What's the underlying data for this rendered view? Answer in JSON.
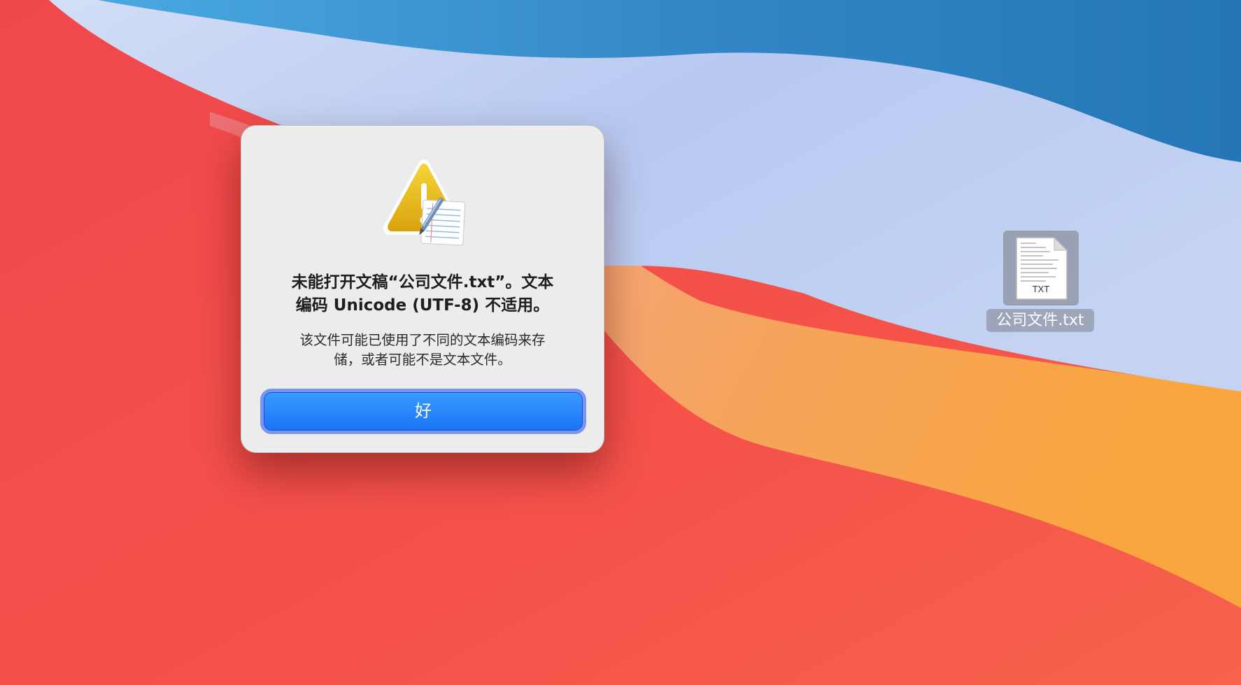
{
  "alert": {
    "icon": "caution-textedit-icon",
    "title_lines": [
      "未能打开文稿“公司文件.txt”。文本",
      "编码 Unicode (UTF-8) 不适用。"
    ],
    "message_lines": [
      "该文件可能已使用了不同的文本编码来存",
      "储，或者可能不是文本文件。"
    ],
    "ok_label": "好"
  },
  "desktop": {
    "file": {
      "icon": "txt-document-icon",
      "extension_badge": "TXT",
      "name": "公司文件.txt"
    }
  },
  "colors": {
    "accent": "#1a74f5",
    "dialog_bg": "#ececec",
    "wallpaper_red": "#f24e4a",
    "wallpaper_orange": "#f8a440",
    "wallpaper_blue": "#2a7fc0"
  }
}
